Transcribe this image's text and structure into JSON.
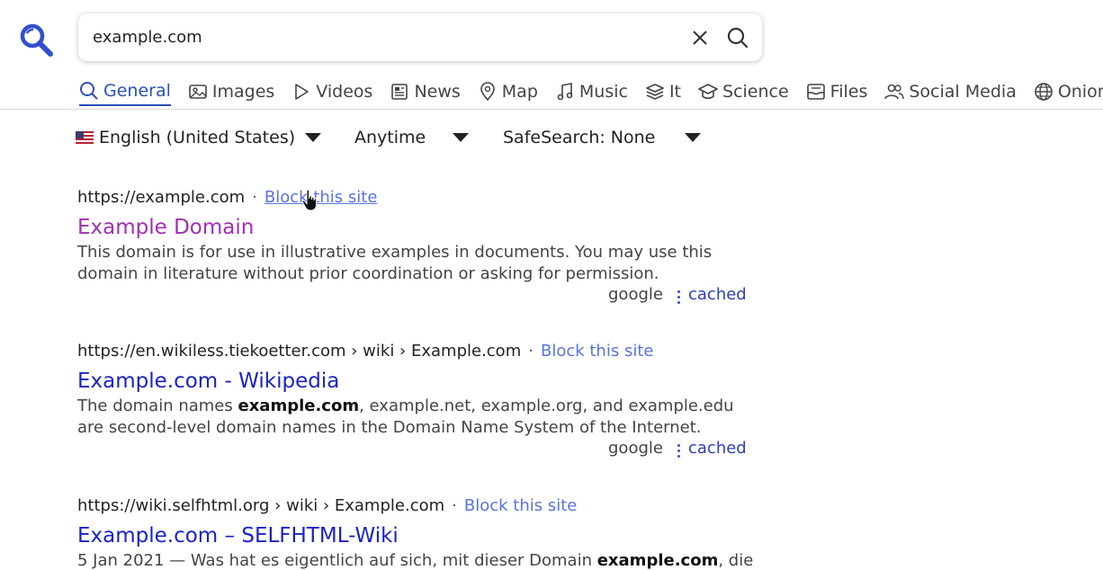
{
  "search": {
    "value": "example.com",
    "placeholder": ""
  },
  "icons": {
    "logo": "magnifier-logo",
    "clear": "close-icon",
    "submit": "search-icon"
  },
  "tabs": [
    {
      "label": "General",
      "icon": "search-icon",
      "active": true
    },
    {
      "label": "Images",
      "icon": "image-icon",
      "active": false
    },
    {
      "label": "Videos",
      "icon": "play-icon",
      "active": false
    },
    {
      "label": "News",
      "icon": "newspaper-icon",
      "active": false
    },
    {
      "label": "Map",
      "icon": "map-pin-icon",
      "active": false
    },
    {
      "label": "Music",
      "icon": "music-note-icon",
      "active": false
    },
    {
      "label": "It",
      "icon": "layers-icon",
      "active": false
    },
    {
      "label": "Science",
      "icon": "graduation-cap-icon",
      "active": false
    },
    {
      "label": "Files",
      "icon": "inbox-icon",
      "active": false
    },
    {
      "label": "Social Media",
      "icon": "users-icon",
      "active": false
    },
    {
      "label": "Onions",
      "icon": "globe-icon",
      "active": false
    }
  ],
  "filters": {
    "language": "English (United States)",
    "time": "Anytime",
    "safesearch": "SafeSearch: None"
  },
  "results": [
    {
      "url": "https://example.com",
      "crumbs": "",
      "block": "Block this site",
      "title": "Example Domain",
      "snippet_parts": [
        "This domain is for use in illustrative examples in documents. You may use this domain in literature without prior coordination or asking for permission."
      ],
      "engine": "google",
      "cached": "cached"
    },
    {
      "url": "https://en.wikiless.tiekoetter.com",
      "crumbs": "› wiki › Example.com",
      "block": "Block this site",
      "title": "Example.com - Wikipedia",
      "snippet_before": "The domain names ",
      "snippet_bold": "example.com",
      "snippet_after": ", example.net, example.org, and example.edu are second-level domain names in the Domain Name System of the Internet.",
      "engine": "google",
      "cached": "cached"
    },
    {
      "url": "https://wiki.selfhtml.org",
      "crumbs": "› wiki › Example.com",
      "block": "Block this site",
      "title": "Example.com – SELFHTML-Wiki",
      "snippet_before": "5 Jan 2021 — Was hat es eigentlich auf sich, mit dieser Domain ",
      "snippet_bold": "example.com",
      "snippet_after": ", die"
    }
  ],
  "colors": {
    "accent": "#2a4fbf",
    "link": "#1a23c4",
    "visited": "#a12fb3",
    "block_link": "#5a73e0"
  }
}
